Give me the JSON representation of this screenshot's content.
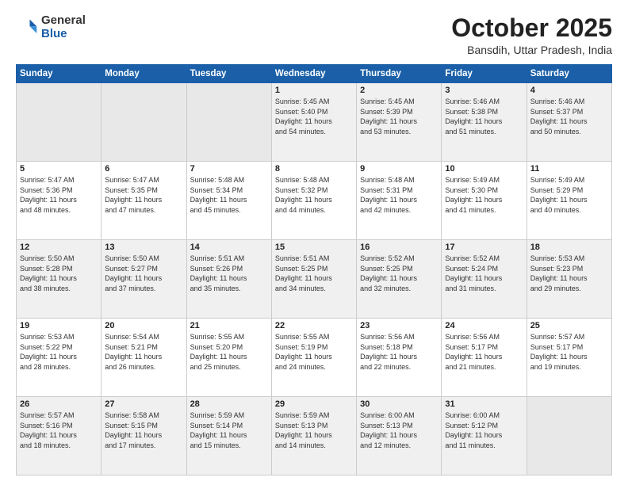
{
  "header": {
    "logo_general": "General",
    "logo_blue": "Blue",
    "month_title": "October 2025",
    "location": "Bansdih, Uttar Pradesh, India"
  },
  "weekdays": [
    "Sunday",
    "Monday",
    "Tuesday",
    "Wednesday",
    "Thursday",
    "Friday",
    "Saturday"
  ],
  "weeks": [
    [
      {
        "day": "",
        "text": ""
      },
      {
        "day": "",
        "text": ""
      },
      {
        "day": "",
        "text": ""
      },
      {
        "day": "1",
        "text": "Sunrise: 5:45 AM\nSunset: 5:40 PM\nDaylight: 11 hours\nand 54 minutes."
      },
      {
        "day": "2",
        "text": "Sunrise: 5:45 AM\nSunset: 5:39 PM\nDaylight: 11 hours\nand 53 minutes."
      },
      {
        "day": "3",
        "text": "Sunrise: 5:46 AM\nSunset: 5:38 PM\nDaylight: 11 hours\nand 51 minutes."
      },
      {
        "day": "4",
        "text": "Sunrise: 5:46 AM\nSunset: 5:37 PM\nDaylight: 11 hours\nand 50 minutes."
      }
    ],
    [
      {
        "day": "5",
        "text": "Sunrise: 5:47 AM\nSunset: 5:36 PM\nDaylight: 11 hours\nand 48 minutes."
      },
      {
        "day": "6",
        "text": "Sunrise: 5:47 AM\nSunset: 5:35 PM\nDaylight: 11 hours\nand 47 minutes."
      },
      {
        "day": "7",
        "text": "Sunrise: 5:48 AM\nSunset: 5:34 PM\nDaylight: 11 hours\nand 45 minutes."
      },
      {
        "day": "8",
        "text": "Sunrise: 5:48 AM\nSunset: 5:32 PM\nDaylight: 11 hours\nand 44 minutes."
      },
      {
        "day": "9",
        "text": "Sunrise: 5:48 AM\nSunset: 5:31 PM\nDaylight: 11 hours\nand 42 minutes."
      },
      {
        "day": "10",
        "text": "Sunrise: 5:49 AM\nSunset: 5:30 PM\nDaylight: 11 hours\nand 41 minutes."
      },
      {
        "day": "11",
        "text": "Sunrise: 5:49 AM\nSunset: 5:29 PM\nDaylight: 11 hours\nand 40 minutes."
      }
    ],
    [
      {
        "day": "12",
        "text": "Sunrise: 5:50 AM\nSunset: 5:28 PM\nDaylight: 11 hours\nand 38 minutes."
      },
      {
        "day": "13",
        "text": "Sunrise: 5:50 AM\nSunset: 5:27 PM\nDaylight: 11 hours\nand 37 minutes."
      },
      {
        "day": "14",
        "text": "Sunrise: 5:51 AM\nSunset: 5:26 PM\nDaylight: 11 hours\nand 35 minutes."
      },
      {
        "day": "15",
        "text": "Sunrise: 5:51 AM\nSunset: 5:25 PM\nDaylight: 11 hours\nand 34 minutes."
      },
      {
        "day": "16",
        "text": "Sunrise: 5:52 AM\nSunset: 5:25 PM\nDaylight: 11 hours\nand 32 minutes."
      },
      {
        "day": "17",
        "text": "Sunrise: 5:52 AM\nSunset: 5:24 PM\nDaylight: 11 hours\nand 31 minutes."
      },
      {
        "day": "18",
        "text": "Sunrise: 5:53 AM\nSunset: 5:23 PM\nDaylight: 11 hours\nand 29 minutes."
      }
    ],
    [
      {
        "day": "19",
        "text": "Sunrise: 5:53 AM\nSunset: 5:22 PM\nDaylight: 11 hours\nand 28 minutes."
      },
      {
        "day": "20",
        "text": "Sunrise: 5:54 AM\nSunset: 5:21 PM\nDaylight: 11 hours\nand 26 minutes."
      },
      {
        "day": "21",
        "text": "Sunrise: 5:55 AM\nSunset: 5:20 PM\nDaylight: 11 hours\nand 25 minutes."
      },
      {
        "day": "22",
        "text": "Sunrise: 5:55 AM\nSunset: 5:19 PM\nDaylight: 11 hours\nand 24 minutes."
      },
      {
        "day": "23",
        "text": "Sunrise: 5:56 AM\nSunset: 5:18 PM\nDaylight: 11 hours\nand 22 minutes."
      },
      {
        "day": "24",
        "text": "Sunrise: 5:56 AM\nSunset: 5:17 PM\nDaylight: 11 hours\nand 21 minutes."
      },
      {
        "day": "25",
        "text": "Sunrise: 5:57 AM\nSunset: 5:17 PM\nDaylight: 11 hours\nand 19 minutes."
      }
    ],
    [
      {
        "day": "26",
        "text": "Sunrise: 5:57 AM\nSunset: 5:16 PM\nDaylight: 11 hours\nand 18 minutes."
      },
      {
        "day": "27",
        "text": "Sunrise: 5:58 AM\nSunset: 5:15 PM\nDaylight: 11 hours\nand 17 minutes."
      },
      {
        "day": "28",
        "text": "Sunrise: 5:59 AM\nSunset: 5:14 PM\nDaylight: 11 hours\nand 15 minutes."
      },
      {
        "day": "29",
        "text": "Sunrise: 5:59 AM\nSunset: 5:13 PM\nDaylight: 11 hours\nand 14 minutes."
      },
      {
        "day": "30",
        "text": "Sunrise: 6:00 AM\nSunset: 5:13 PM\nDaylight: 11 hours\nand 12 minutes."
      },
      {
        "day": "31",
        "text": "Sunrise: 6:00 AM\nSunset: 5:12 PM\nDaylight: 11 hours\nand 11 minutes."
      },
      {
        "day": "",
        "text": ""
      }
    ]
  ]
}
